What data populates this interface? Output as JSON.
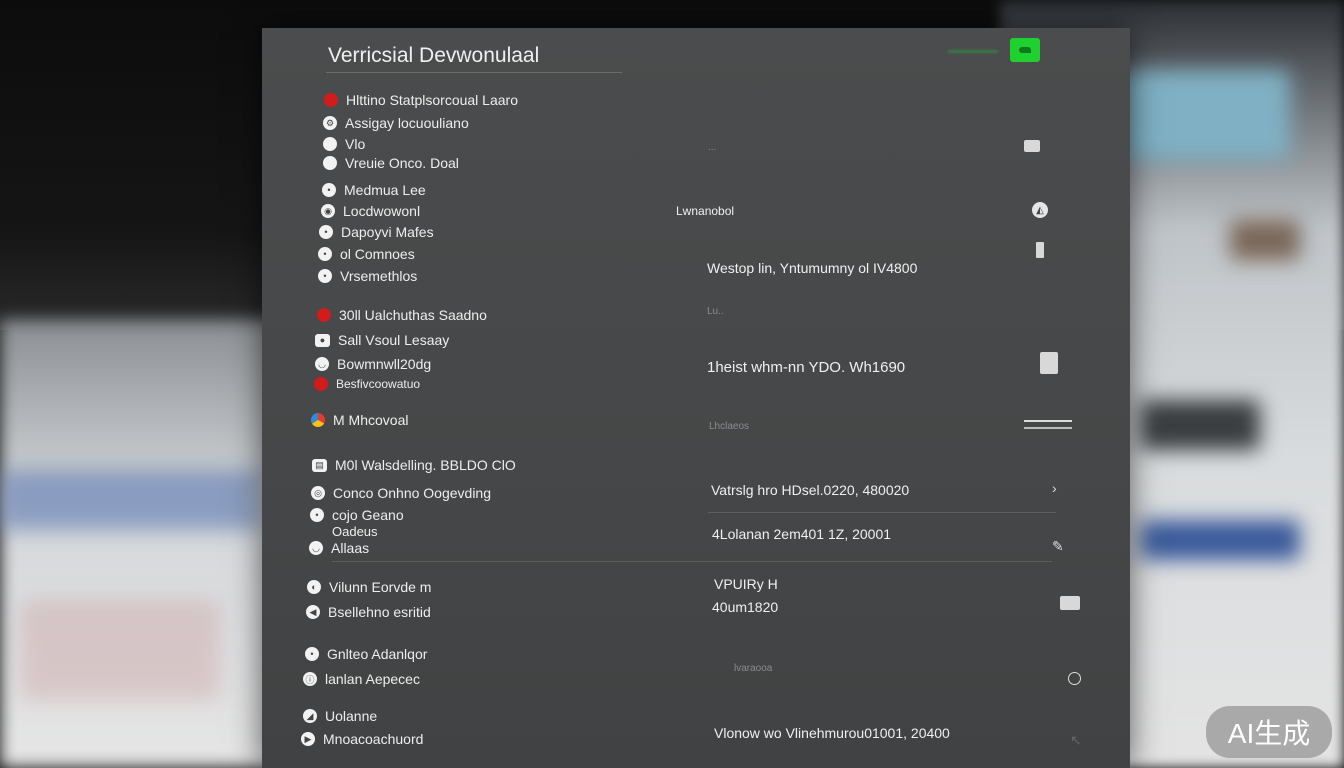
{
  "window": {
    "title": "Verricsial Devwonulaal"
  },
  "left_items": [
    {
      "label": "Hlttino Statplsorcoual Laaro",
      "icon": "red-dot-icon"
    },
    {
      "label": "Assigay locuouliano",
      "icon": "circle-icon"
    },
    {
      "label": "Vlo",
      "icon": "circle-icon"
    },
    {
      "label": "Vreuie Onco. Doal",
      "icon": "circle-icon"
    },
    {
      "label": "Medmua Lee",
      "icon": "circle-icon"
    },
    {
      "label": "Locdwowonl",
      "icon": "circle-icon"
    },
    {
      "label": "Dapoyvi Mafes",
      "icon": "circle-icon"
    },
    {
      "label": "ol Comnoes",
      "icon": "circle-icon"
    },
    {
      "label": "Vrsemethlos",
      "icon": "circle-icon"
    },
    {
      "label": "30ll Ualchuthas Saadno",
      "icon": "red-dot-icon"
    },
    {
      "label": "Sall Vsoul Lesaay",
      "icon": "square-icon"
    },
    {
      "label": "Bowmnwll20dg",
      "icon": "circle-icon"
    },
    {
      "label": "Besfivcoowatuo",
      "icon": "red-dot-icon"
    },
    {
      "label": "M Mhcovoal",
      "icon": "multicolor-icon"
    },
    {
      "label": "M0l Walsdelling. BBLDO ClO",
      "icon": "square-icon"
    },
    {
      "label": "Conco Onhno Oogevding",
      "icon": "circle-icon"
    },
    {
      "label": "cojo Geano",
      "icon": "circle-icon"
    },
    {
      "label": "Oadeus",
      "icon": "circle-icon"
    },
    {
      "label": "Allaas",
      "icon": "circle-icon"
    },
    {
      "label": "Vilunn Eorvde m",
      "icon": "circle-icon"
    },
    {
      "label": "Bsellehno esritid",
      "icon": "circle-icon"
    },
    {
      "label": "Gnlteo Adanlqor",
      "icon": "circle-icon"
    },
    {
      "label": "lanlan Aepecec",
      "icon": "circle-icon"
    },
    {
      "label": "Uolanne",
      "icon": "circle-icon"
    },
    {
      "label": "Mnoacoachuord",
      "icon": "circle-icon"
    }
  ],
  "values": {
    "v1": "Lwnanobol",
    "v2": "Westop lin, Yntumumny ol IV4800",
    "v3": "1heist whm-nn YDO. Wh1690",
    "v4": "Vatrslg hro HDsel.0220, 480020",
    "v5": "4Lolanan 2em401 1Z, 20001",
    "v6": "VPUIRy H",
    "v7": "40um1820",
    "v8": "Vlonow wo Vlinehmurou01001, 20400",
    "dim1": "...",
    "dim2": "Lu..",
    "dim3": "Lhclaeos",
    "dim4": "lvaraooa"
  },
  "right_icons": [
    "monitor-icon",
    "box-icon",
    "person-icon",
    "kiosk-icon",
    "person-icon",
    "bar-icon",
    "chevron-right-icon",
    "pen-icon",
    "box-icon",
    "radio-icon",
    "arrow-icon"
  ],
  "watermark": "AI生成"
}
